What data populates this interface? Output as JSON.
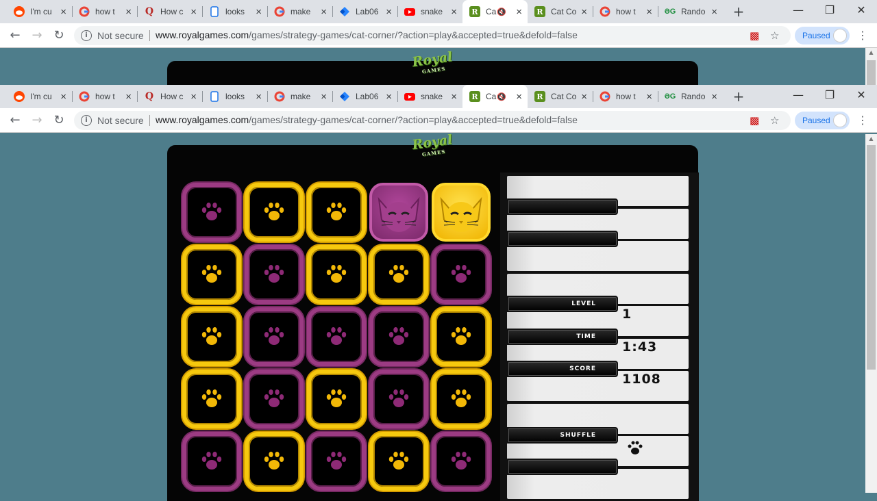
{
  "browser": {
    "tabs": [
      {
        "title": "I'm cu",
        "icon": "reddit-icon",
        "color": "#ff4500"
      },
      {
        "title": "how t",
        "icon": "google-icon",
        "color": "#4285f4"
      },
      {
        "title": "How c",
        "icon": "quora-icon",
        "color": "#b92b27"
      },
      {
        "title": "looks",
        "icon": "page-icon",
        "color": "#1a73e8"
      },
      {
        "title": "make",
        "icon": "google-icon",
        "color": "#4285f4"
      },
      {
        "title": "Lab06",
        "icon": "jira-icon",
        "color": "#2684ff"
      },
      {
        "title": "snake",
        "icon": "youtube-icon",
        "color": "#ff0000"
      },
      {
        "title": "Ca",
        "icon": "royalgames-icon",
        "color": "#5a8f1e",
        "active": true,
        "muted": true
      },
      {
        "title": "Cat Co",
        "icon": "royalgames-icon",
        "color": "#5a8f1e"
      },
      {
        "title": "how t",
        "icon": "google-icon",
        "color": "#4285f4"
      },
      {
        "title": "Rando",
        "icon": "random-icon",
        "color": "#1e8e3e"
      }
    ],
    "security": "Not secure",
    "url_host": "www.royalgames.com",
    "url_path": "/games/strategy-games/cat-corner/?action=play&accepted=true&defold=false",
    "profile_status": "Paused"
  },
  "game": {
    "logo": "Royal",
    "logo_sub": "GAMES",
    "grid": [
      [
        "purple",
        "yellow",
        "yellow",
        "cat-purple",
        "cat-yellow"
      ],
      [
        "yellow",
        "purple",
        "yellow",
        "yellow",
        "purple"
      ],
      [
        "yellow",
        "purple",
        "purple",
        "purple",
        "yellow"
      ],
      [
        "yellow",
        "purple",
        "yellow",
        "purple",
        "yellow"
      ],
      [
        "purple",
        "yellow",
        "purple",
        "yellow",
        "purple"
      ]
    ],
    "colors": {
      "yellow": "#f6c90e",
      "purple": "#9c3b83"
    },
    "level_label": "LEVEL",
    "level": "1",
    "time_label": "TIME",
    "time": "1:43",
    "score_label": "SCORE",
    "score": "1108",
    "shuffle_label": "SHUFFLE"
  }
}
